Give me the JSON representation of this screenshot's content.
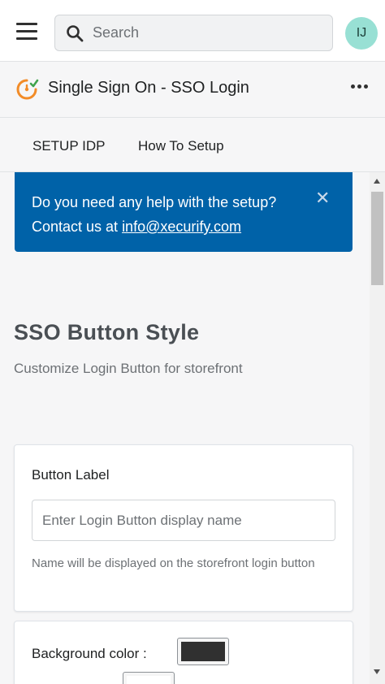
{
  "topbar": {
    "search_placeholder": "Search",
    "avatar_initials": "IJ",
    "avatar_color": "#98e0d4"
  },
  "app": {
    "title": "Single Sign On - SSO Login",
    "logo_icon": "sso-logo-icon",
    "more_icon": "ellipsis-icon"
  },
  "nav": {
    "tabs": [
      {
        "label": "SETUP IDP"
      },
      {
        "label": "How To Setup"
      }
    ]
  },
  "banner": {
    "line1": "Do you need any help with the setup?",
    "line2_prefix": "Contact us at ",
    "email": "info@xecurify.com",
    "color": "#0062a8",
    "close_icon": "close-icon"
  },
  "section": {
    "title": "SSO Button Style",
    "subtitle": "Customize Login Button for storefront"
  },
  "button_label_card": {
    "label": "Button Label",
    "placeholder": "Enter Login Button display name",
    "help": "Name will be displayed on the storefront login button"
  },
  "color_card": {
    "background_label": "Background color :",
    "background_color": "#303030",
    "second_color": "#ffffff"
  }
}
